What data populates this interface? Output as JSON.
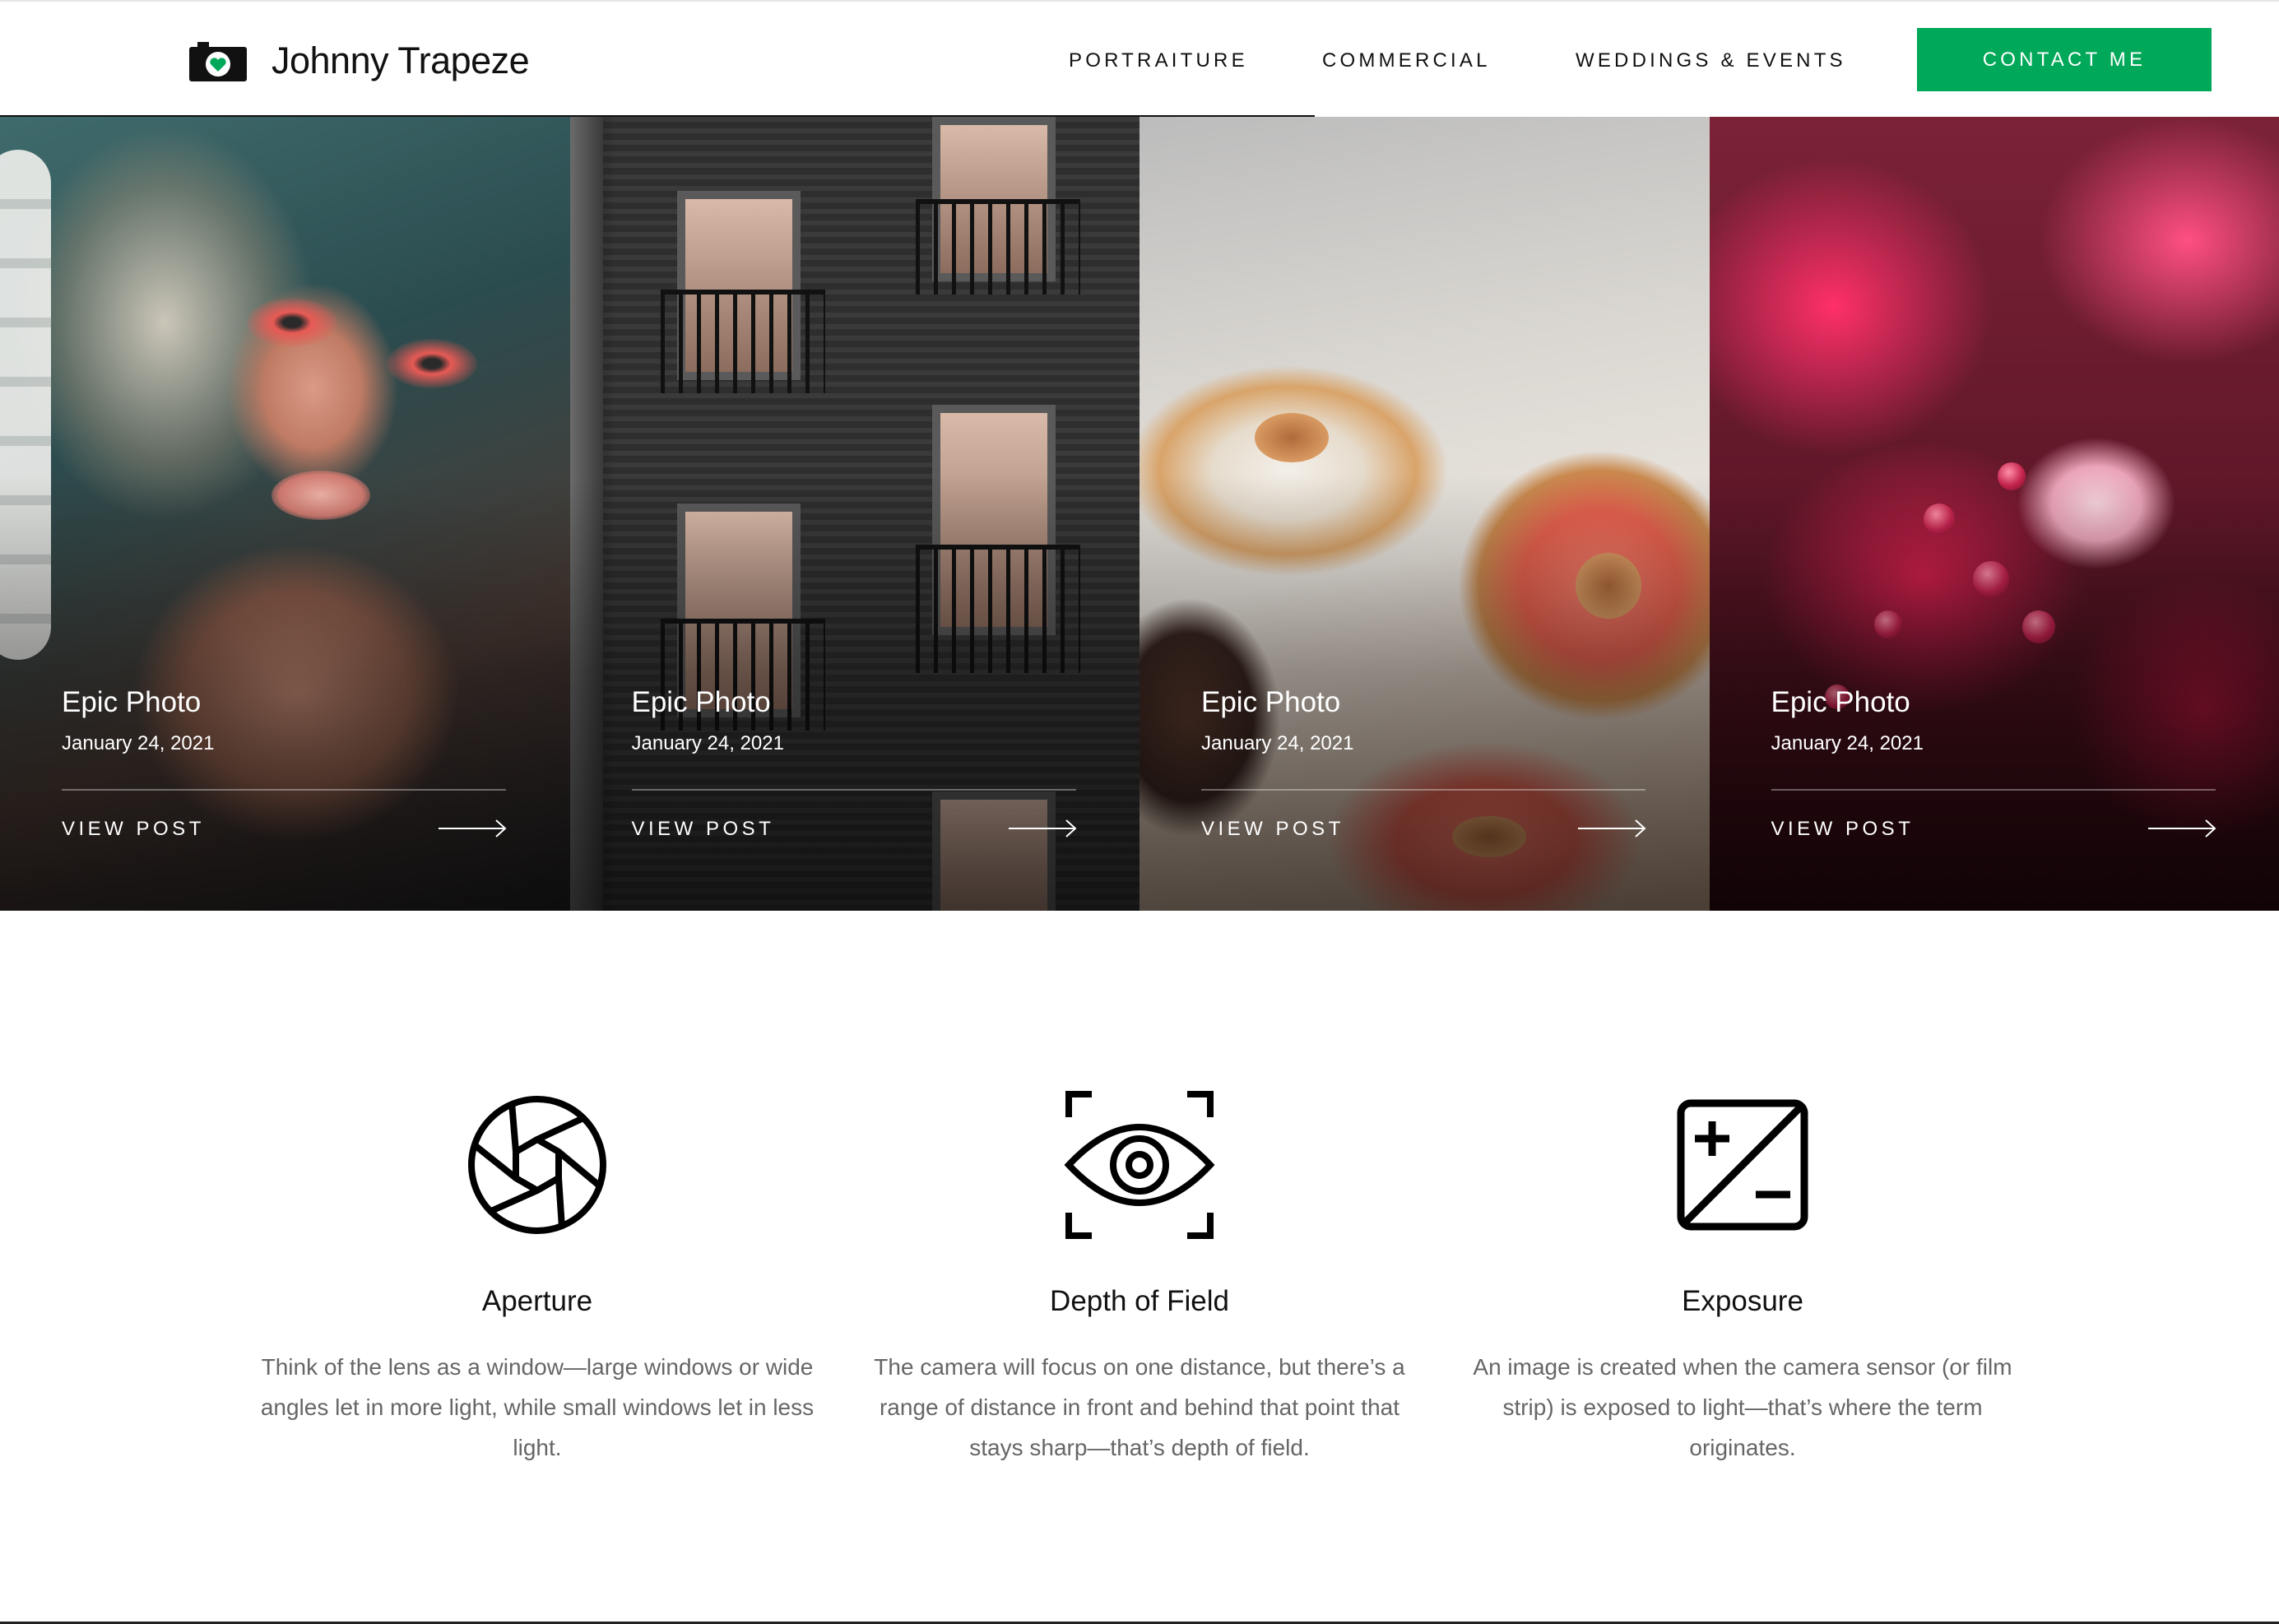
{
  "header": {
    "brand": "Johnny Trapeze",
    "logo_icon": "camera-heart-icon",
    "nav": [
      {
        "label": "PORTRAITURE"
      },
      {
        "label": "COMMERCIAL"
      },
      {
        "label": "WEDDINGS & EVENTS"
      }
    ],
    "cta": "CONTACT ME"
  },
  "gallery": {
    "cards": [
      {
        "title": "Epic Photo",
        "date": "January 24, 2021",
        "link": "VIEW POST",
        "subject": "portrait"
      },
      {
        "title": "Epic Photo",
        "date": "January 24, 2021",
        "link": "VIEW POST",
        "subject": "building"
      },
      {
        "title": "Epic Photo",
        "date": "January 24, 2021",
        "link": "VIEW POST",
        "subject": "donuts"
      },
      {
        "title": "Epic Photo",
        "date": "January 24, 2021",
        "link": "VIEW POST",
        "subject": "blossoms"
      }
    ]
  },
  "features": [
    {
      "icon": "aperture-icon",
      "title": "Aperture",
      "text": "Think of the lens as a window—large windows or wide angles let in more light, while small windows let in less light."
    },
    {
      "icon": "eye-focus-icon",
      "title": "Depth of Field",
      "text": "The camera will focus on one distance, but there’s a range of distance in front and behind that point that stays sharp—that’s depth of field."
    },
    {
      "icon": "exposure-icon",
      "title": "Exposure",
      "text": "An image is created when the camera sensor (or film strip) is exposed to light—that’s where the term originates."
    }
  ],
  "colors": {
    "accent": "#00a859",
    "text": "#111111",
    "muted": "#666666"
  }
}
